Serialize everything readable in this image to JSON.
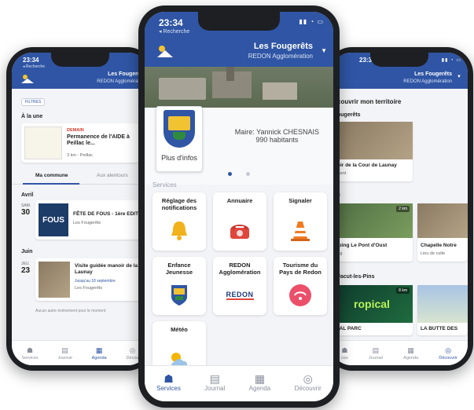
{
  "center": {
    "time": "23:34",
    "back": "◂ Recherche",
    "town": "Les Fougerêts",
    "agglo": "REDON Agglomération",
    "plus_infos": "Plus d'infos",
    "mayor": "Maire: Yannick CHESNAIS",
    "population": "990 habitants",
    "services_title": "Services",
    "services": [
      {
        "label": "Réglage des notifications",
        "icon": "bell-icon"
      },
      {
        "label": "Annuaire",
        "icon": "phone-icon"
      },
      {
        "label": "Signaler",
        "icon": "traffic-cone-icon"
      },
      {
        "label": "Enfance Jeunesse",
        "icon": "crest-icon"
      },
      {
        "label": "REDON Agglomération",
        "icon": "redon-logo",
        "logo_text": "REDON"
      },
      {
        "label": "Tourisme du Pays de Redon",
        "icon": "tourisme-logo"
      },
      {
        "label": "Météo",
        "icon": "weather-icon"
      }
    ],
    "tabs": [
      "Services",
      "Journal",
      "Agenda",
      "Découvrir"
    ]
  },
  "left": {
    "time": "23:34",
    "back": "◂ Recherche",
    "town": "Les Fougerêts",
    "agglo": "REDON Agglomération",
    "filters": "FILTRES",
    "a_la_une": "À la une",
    "news_tag": "DEMAIN",
    "news_title": "Permanence de l'AIDE à Peillac le...",
    "news_meta": "3 km - Peillac",
    "tab_commune": "Ma commune",
    "tab_alentours": "Aux alentours",
    "month1": "Avril",
    "ev1_day": "SAM.",
    "ev1_num": "30",
    "ev1_title": "FÊTE DE FOUS - 1ère EDITIO",
    "ev1_place": "Les Fougerêts",
    "ev1_thumb_text": "FOUS",
    "month2": "Juin",
    "ev2_day": "JEU.",
    "ev2_num": "23",
    "ev2_title": "Visite guidée manoir de la C de Launay",
    "ev2_until": "Jusqu'au 18 septembre",
    "ev2_place": "Les Fougerêts",
    "no_more": "Aucun autre événement pour le moment",
    "tabs": [
      "Services",
      "Journal",
      "Agenda",
      "Décou"
    ]
  },
  "right": {
    "time": "23:34",
    "town": "Les Fougerêts",
    "agglo": "REDON Agglomération",
    "heading": "couvrir mon territoire",
    "sec1": "ougerêts",
    "card1_title": "noir de la Cour de Launay",
    "card1_sub": "ument",
    "sec2": "c",
    "card2_badge": "2 km",
    "card2_title": "mping Le Pont d'Oust",
    "card2_sub": "ping",
    "card3_title": "Chapelle Notre",
    "card3_sub": "Lieu de culte",
    "sec3": "Jacut-les-Pins",
    "card4_badge": "8 km",
    "card4_logo": "ropical",
    "card4_title": "ICAL PARC",
    "card5_title": "LA BUTTE DES",
    "tabs": [
      "ces",
      "Journal",
      "Agenda",
      "Découvrir"
    ]
  },
  "colors": {
    "primary": "#2f55a4",
    "demain": "#d23a2a"
  }
}
